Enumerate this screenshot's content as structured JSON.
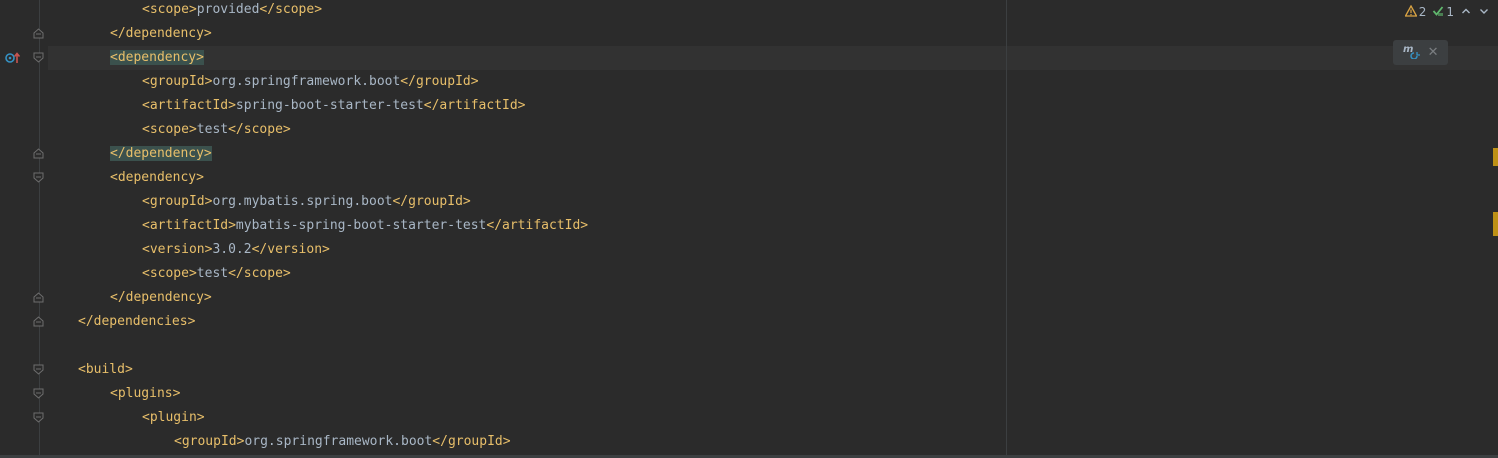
{
  "editor": {
    "lines": [
      {
        "indent": 3,
        "open": "<scope>",
        "text": "provided",
        "close": "</scope>"
      },
      {
        "indent": 2,
        "single": "</dependency>"
      },
      {
        "indent": 2,
        "single": "<dependency>"
      },
      {
        "indent": 3,
        "open": "<groupId>",
        "text": "org.springframework.boot",
        "close": "</groupId>"
      },
      {
        "indent": 3,
        "open": "<artifactId>",
        "text": "spring-boot-starter-test",
        "close": "</artifactId>"
      },
      {
        "indent": 3,
        "open": "<scope>",
        "text": "test",
        "close": "</scope>"
      },
      {
        "indent": 2,
        "single": "</dependency>"
      },
      {
        "indent": 2,
        "single": "<dependency>"
      },
      {
        "indent": 3,
        "open": "<groupId>",
        "text": "org.mybatis.spring.boot",
        "close": "</groupId>"
      },
      {
        "indent": 3,
        "open": "<artifactId>",
        "text": "mybatis-spring-boot-starter-test",
        "close": "</artifactId>"
      },
      {
        "indent": 3,
        "open": "<version>",
        "text": "3.0.2",
        "close": "</version>"
      },
      {
        "indent": 3,
        "open": "<scope>",
        "text": "test",
        "close": "</scope>"
      },
      {
        "indent": 2,
        "single": "</dependency>"
      },
      {
        "indent": 1,
        "single": "</dependencies>"
      },
      {
        "indent": 0,
        "single": ""
      },
      {
        "indent": 1,
        "single": "<build>"
      },
      {
        "indent": 2,
        "single": "<plugins>"
      },
      {
        "indent": 3,
        "single": "<plugin>"
      },
      {
        "indent": 4,
        "open": "<groupId>",
        "text": "org.springframework.boot",
        "close": "</groupId>"
      }
    ],
    "current_line": 2,
    "highlighted_lines": [
      2,
      6
    ]
  },
  "inspection": {
    "warnings": "2",
    "ok": "1",
    "warning_icon": "warning-triangle-icon",
    "ok_icon": "check-icon"
  },
  "maven_popup": {
    "icon": "maven-reload-icon",
    "close_label": "✕"
  },
  "colors": {
    "tag": "#e8bf6a",
    "text": "#a9b7c6",
    "background": "#2b2b2b",
    "match_highlight": "#3b514d",
    "warning_stripe": "#be9117"
  }
}
